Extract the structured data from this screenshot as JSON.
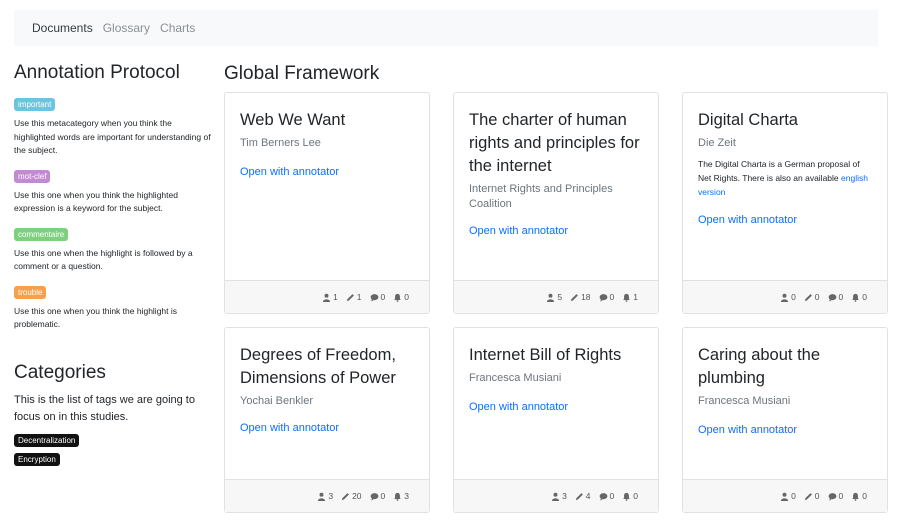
{
  "nav": {
    "items": [
      "Documents",
      "Glossary",
      "Charts"
    ]
  },
  "left": {
    "protocol_title": "Annotation Protocol",
    "tags": [
      {
        "label": "important",
        "color": "#6cc5e0",
        "desc": "Use this metacategory when you think the highlighted words are important for understanding of the subject."
      },
      {
        "label": "mot-clef",
        "color": "#c38ad4",
        "desc": "Use this one when you think the highlighted expression is a keyword for the subject."
      },
      {
        "label": "commentaire",
        "color": "#7ed07e",
        "desc": "Use this one when the highlight is followed by a comment or a question."
      },
      {
        "label": "trouble",
        "color": "#f4a04e",
        "desc": "Use this one when you think the highlight is problematic."
      }
    ],
    "categories_title": "Categories",
    "categories_desc": "This is the list of tags we are going to focus on in this studies.",
    "categories": [
      "Decentralization",
      "Encryption"
    ]
  },
  "main": {
    "title": "Global Framework",
    "open_label": "Open with annotator",
    "cards": [
      {
        "title": "Web We Want",
        "author": "Tim Berners Lee",
        "stats": [
          "1",
          "1",
          "0",
          "0"
        ]
      },
      {
        "title": "The charter of human rights and principles for the internet",
        "author": "Internet Rights and Principles Coalition",
        "stats": [
          "5",
          "18",
          "0",
          "1"
        ]
      },
      {
        "title": "Digital Charta",
        "author": "Die Zeit",
        "desc": "The Digital Charta is a German proposal of Net Rights. There is also an available",
        "desc_link": "english version",
        "stats": [
          "0",
          "0",
          "0",
          "0"
        ]
      },
      {
        "title": "Degrees of Freedom, Dimensions of Power",
        "author": "Yochai Benkler",
        "stats": [
          "3",
          "20",
          "0",
          "3"
        ]
      },
      {
        "title": "Internet Bill of Rights",
        "author": "Francesca Musiani",
        "stats": [
          "3",
          "4",
          "0",
          "0"
        ]
      },
      {
        "title": "Caring about the plumbing",
        "author": "Francesca Musiani",
        "stats": [
          "0",
          "0",
          "0",
          "0"
        ]
      }
    ],
    "stat_icons": [
      "users-icon",
      "pencil-icon",
      "comment-icon",
      "bell-icon"
    ]
  }
}
